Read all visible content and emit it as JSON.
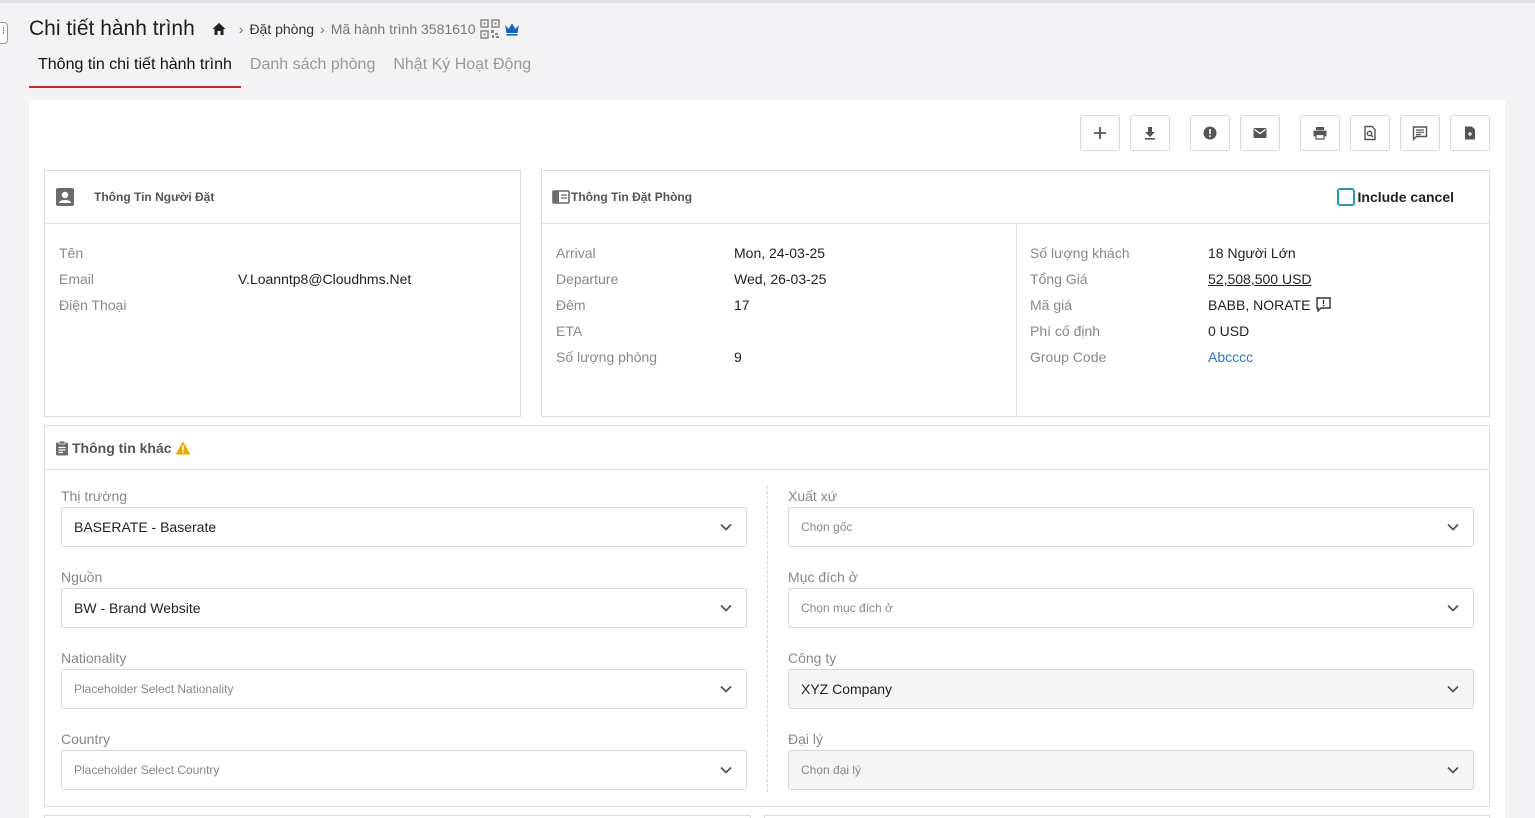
{
  "header": {
    "title": "Chi tiết hành trình",
    "breadcrumb_link": "Đặt phòng",
    "breadcrumb_current": "Mã hành trình 3581610"
  },
  "tabs": [
    {
      "label": "Thông tin chi tiết hành trình",
      "active": true
    },
    {
      "label": "Danh sách phòng",
      "active": false
    },
    {
      "label": "Nhật Ký Hoạt Động",
      "active": false
    }
  ],
  "toolbar": {
    "icons": [
      "plus-icon",
      "download-icon",
      "alert-icon",
      "mail-icon",
      "print-icon",
      "preview-icon",
      "comment-icon",
      "document-icon"
    ]
  },
  "booker": {
    "title": "Thông Tin Người Đặt",
    "rows": [
      {
        "label": "Tên",
        "value": ""
      },
      {
        "label": "Email",
        "value": "V.Loanntp8@Cloudhms.Net"
      },
      {
        "label": "Điện Thoại",
        "value": ""
      }
    ]
  },
  "booking": {
    "title": "Thông Tin Đặt Phòng",
    "include_cancel_label": "Include cancel",
    "left_rows": [
      {
        "label": "Arrival",
        "value": "Mon, 24-03-25"
      },
      {
        "label": "Departure",
        "value": "Wed, 26-03-25"
      },
      {
        "label": "Đêm",
        "value": "17"
      },
      {
        "label": "ETA",
        "value": ""
      },
      {
        "label": "Số lượng phòng",
        "value": "9"
      }
    ],
    "right_rows": [
      {
        "label": "Số lượng khách",
        "value": "18 Người Lớn"
      },
      {
        "label": "Tổng Giá",
        "value": "52,508,500 USD"
      },
      {
        "label": "Mã giá",
        "value": "BABB, NORATE"
      },
      {
        "label": "Phí cố định",
        "value": "0 USD"
      },
      {
        "label": "Group Code",
        "value": "Abcccc"
      }
    ]
  },
  "other": {
    "title": "Thông tin khác",
    "left_fields": [
      {
        "label": "Thị trường",
        "value": "BASERATE - Baserate",
        "placeholder": ""
      },
      {
        "label": "Nguồn",
        "value": "BW - Brand Website",
        "placeholder": ""
      },
      {
        "label": "Nationality",
        "value": "",
        "placeholder": "Placeholder Select Nationality"
      },
      {
        "label": "Country",
        "value": "",
        "placeholder": "Placeholder Select Country"
      }
    ],
    "right_fields": [
      {
        "label": "Xuất xứ",
        "value": "",
        "placeholder": "Chọn gốc"
      },
      {
        "label": "Mục đích ở",
        "value": "",
        "placeholder": "Chọn mục đích ở"
      },
      {
        "label": "Công ty",
        "value": "XYZ Company",
        "placeholder": ""
      },
      {
        "label": "Đại lý",
        "value": "",
        "placeholder": "Chọn đại lý"
      }
    ]
  },
  "colors": {
    "accent_red": "#c62828",
    "link_blue": "#1f77d0",
    "crown_blue": "#1565c0",
    "warning": "#f0a500",
    "checkbox": "#2a9bb5"
  }
}
